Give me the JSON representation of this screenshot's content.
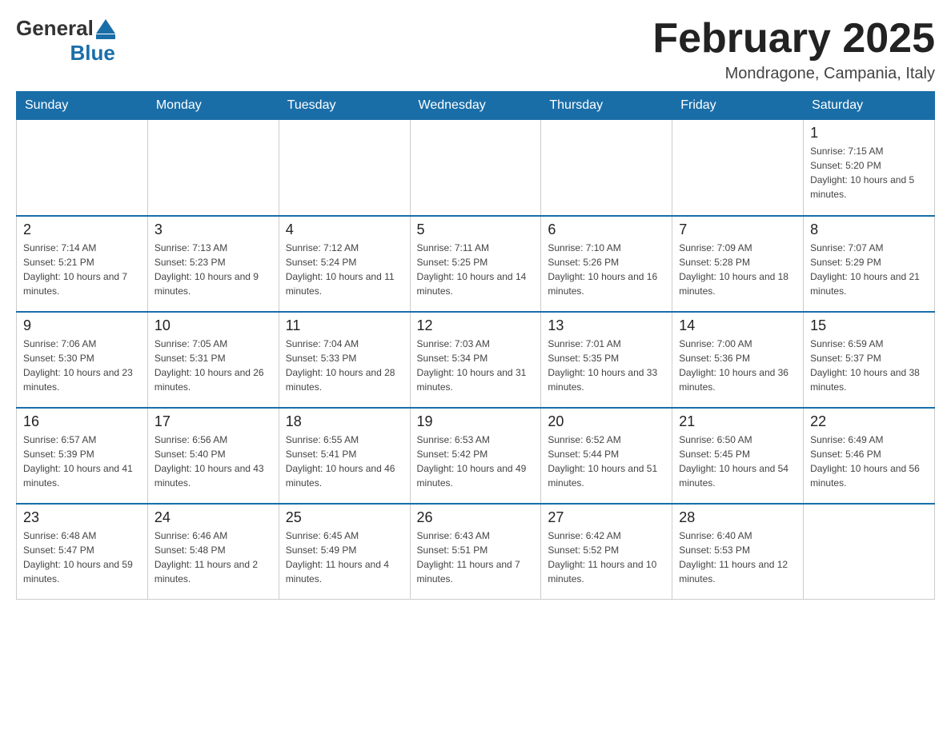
{
  "header": {
    "logo_general": "General",
    "logo_blue": "Blue",
    "month_title": "February 2025",
    "location": "Mondragone, Campania, Italy"
  },
  "weekdays": [
    "Sunday",
    "Monday",
    "Tuesday",
    "Wednesday",
    "Thursday",
    "Friday",
    "Saturday"
  ],
  "weeks": [
    [
      {
        "day": "",
        "info": ""
      },
      {
        "day": "",
        "info": ""
      },
      {
        "day": "",
        "info": ""
      },
      {
        "day": "",
        "info": ""
      },
      {
        "day": "",
        "info": ""
      },
      {
        "day": "",
        "info": ""
      },
      {
        "day": "1",
        "info": "Sunrise: 7:15 AM\nSunset: 5:20 PM\nDaylight: 10 hours and 5 minutes."
      }
    ],
    [
      {
        "day": "2",
        "info": "Sunrise: 7:14 AM\nSunset: 5:21 PM\nDaylight: 10 hours and 7 minutes."
      },
      {
        "day": "3",
        "info": "Sunrise: 7:13 AM\nSunset: 5:23 PM\nDaylight: 10 hours and 9 minutes."
      },
      {
        "day": "4",
        "info": "Sunrise: 7:12 AM\nSunset: 5:24 PM\nDaylight: 10 hours and 11 minutes."
      },
      {
        "day": "5",
        "info": "Sunrise: 7:11 AM\nSunset: 5:25 PM\nDaylight: 10 hours and 14 minutes."
      },
      {
        "day": "6",
        "info": "Sunrise: 7:10 AM\nSunset: 5:26 PM\nDaylight: 10 hours and 16 minutes."
      },
      {
        "day": "7",
        "info": "Sunrise: 7:09 AM\nSunset: 5:28 PM\nDaylight: 10 hours and 18 minutes."
      },
      {
        "day": "8",
        "info": "Sunrise: 7:07 AM\nSunset: 5:29 PM\nDaylight: 10 hours and 21 minutes."
      }
    ],
    [
      {
        "day": "9",
        "info": "Sunrise: 7:06 AM\nSunset: 5:30 PM\nDaylight: 10 hours and 23 minutes."
      },
      {
        "day": "10",
        "info": "Sunrise: 7:05 AM\nSunset: 5:31 PM\nDaylight: 10 hours and 26 minutes."
      },
      {
        "day": "11",
        "info": "Sunrise: 7:04 AM\nSunset: 5:33 PM\nDaylight: 10 hours and 28 minutes."
      },
      {
        "day": "12",
        "info": "Sunrise: 7:03 AM\nSunset: 5:34 PM\nDaylight: 10 hours and 31 minutes."
      },
      {
        "day": "13",
        "info": "Sunrise: 7:01 AM\nSunset: 5:35 PM\nDaylight: 10 hours and 33 minutes."
      },
      {
        "day": "14",
        "info": "Sunrise: 7:00 AM\nSunset: 5:36 PM\nDaylight: 10 hours and 36 minutes."
      },
      {
        "day": "15",
        "info": "Sunrise: 6:59 AM\nSunset: 5:37 PM\nDaylight: 10 hours and 38 minutes."
      }
    ],
    [
      {
        "day": "16",
        "info": "Sunrise: 6:57 AM\nSunset: 5:39 PM\nDaylight: 10 hours and 41 minutes."
      },
      {
        "day": "17",
        "info": "Sunrise: 6:56 AM\nSunset: 5:40 PM\nDaylight: 10 hours and 43 minutes."
      },
      {
        "day": "18",
        "info": "Sunrise: 6:55 AM\nSunset: 5:41 PM\nDaylight: 10 hours and 46 minutes."
      },
      {
        "day": "19",
        "info": "Sunrise: 6:53 AM\nSunset: 5:42 PM\nDaylight: 10 hours and 49 minutes."
      },
      {
        "day": "20",
        "info": "Sunrise: 6:52 AM\nSunset: 5:44 PM\nDaylight: 10 hours and 51 minutes."
      },
      {
        "day": "21",
        "info": "Sunrise: 6:50 AM\nSunset: 5:45 PM\nDaylight: 10 hours and 54 minutes."
      },
      {
        "day": "22",
        "info": "Sunrise: 6:49 AM\nSunset: 5:46 PM\nDaylight: 10 hours and 56 minutes."
      }
    ],
    [
      {
        "day": "23",
        "info": "Sunrise: 6:48 AM\nSunset: 5:47 PM\nDaylight: 10 hours and 59 minutes."
      },
      {
        "day": "24",
        "info": "Sunrise: 6:46 AM\nSunset: 5:48 PM\nDaylight: 11 hours and 2 minutes."
      },
      {
        "day": "25",
        "info": "Sunrise: 6:45 AM\nSunset: 5:49 PM\nDaylight: 11 hours and 4 minutes."
      },
      {
        "day": "26",
        "info": "Sunrise: 6:43 AM\nSunset: 5:51 PM\nDaylight: 11 hours and 7 minutes."
      },
      {
        "day": "27",
        "info": "Sunrise: 6:42 AM\nSunset: 5:52 PM\nDaylight: 11 hours and 10 minutes."
      },
      {
        "day": "28",
        "info": "Sunrise: 6:40 AM\nSunset: 5:53 PM\nDaylight: 11 hours and 12 minutes."
      },
      {
        "day": "",
        "info": ""
      }
    ]
  ]
}
